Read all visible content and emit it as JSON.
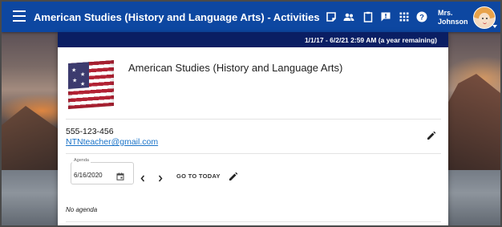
{
  "header": {
    "title": "American Studies (History and Language Arts) - Activities",
    "user_name_line1": "Mrs.",
    "user_name_line2": "Johnson",
    "bar_color": "#0d47a1",
    "icons": [
      "menu-icon",
      "notes-icon",
      "people-icon",
      "clipboard-icon",
      "alert-icon",
      "apps-icon",
      "help-icon"
    ]
  },
  "card": {
    "date_range": "1/1/17 - 6/2/21 2:59 AM (a year remaining)",
    "class_title": "American Studies (History and Language Arts)",
    "phone": "555-123-456",
    "email": "NTNteacher@gmail.com",
    "header_color": "#0a1e63",
    "email_color": "#1a73c8"
  },
  "agenda": {
    "legend": "Agenda",
    "date": "6/16/2020",
    "go_today_label": "GO TO TODAY",
    "empty_text": "No agenda"
  }
}
